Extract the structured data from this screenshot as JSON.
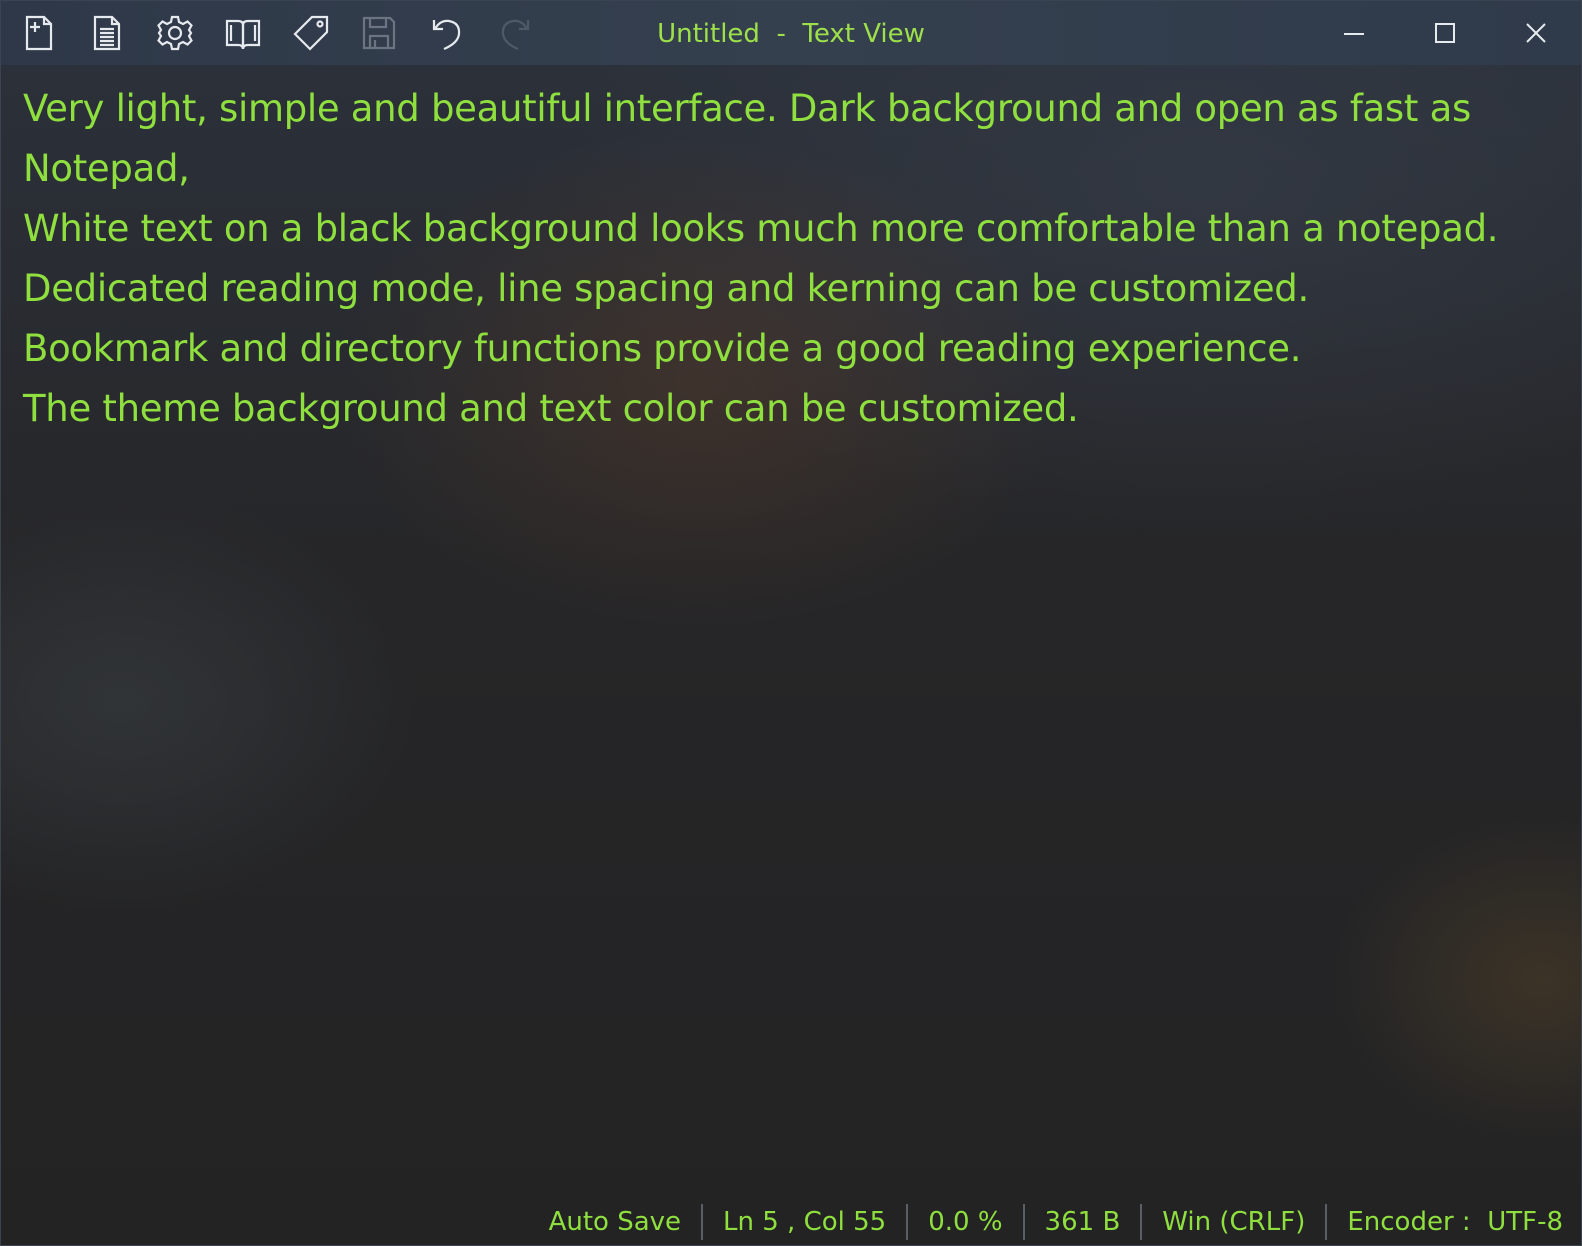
{
  "window": {
    "title": "Untitled  -  Text View",
    "controls": {
      "minimize": "minimize-icon",
      "maximize": "maximize-icon",
      "close": "close-icon"
    }
  },
  "toolbar": {
    "items": [
      {
        "icon": "new-file-icon",
        "enabled": true
      },
      {
        "icon": "document-icon",
        "enabled": true
      },
      {
        "icon": "gear-icon",
        "enabled": true
      },
      {
        "icon": "book-icon",
        "enabled": true
      },
      {
        "icon": "tag-icon",
        "enabled": true
      },
      {
        "icon": "save-icon",
        "enabled": false
      },
      {
        "icon": "undo-icon",
        "enabled": true
      },
      {
        "icon": "redo-icon",
        "enabled": false
      }
    ]
  },
  "editor": {
    "lines": [
      "Very light, simple and beautiful interface. Dark background and open as fast as Notepad,",
      "White text on a black background looks much more comfortable than a notepad.",
      "Dedicated reading mode, line spacing and kerning can be customized.",
      "Bookmark and directory functions provide a good reading experience.",
      "The theme background and text color can be customized."
    ]
  },
  "status": {
    "auto_save": "Auto Save",
    "position": "Ln 5 , Col 55",
    "progress": "0.0 %",
    "size": "361 B",
    "line_ending": "Win (CRLF)",
    "encoder": "Encoder :  UTF-8"
  },
  "colors": {
    "text": "#8fe03e",
    "title_text": "#9ee04a",
    "titlebar": "#35404f",
    "background": "#242425",
    "icon": "#e6e9ee",
    "icon_disabled": "#6b7480"
  }
}
